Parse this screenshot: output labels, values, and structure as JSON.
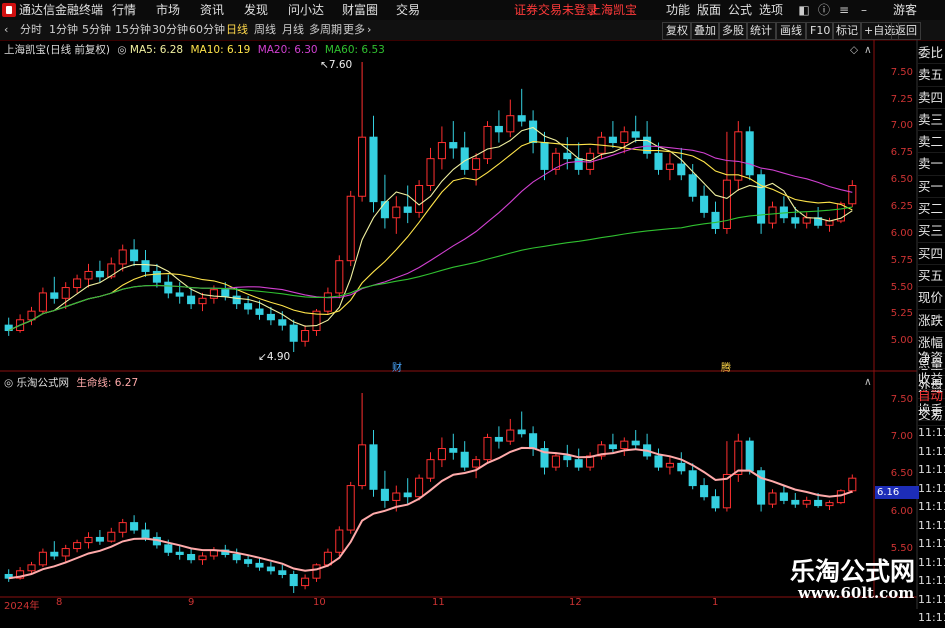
{
  "app": {
    "title": "通达信金融终端",
    "menu": [
      "行情",
      "市场",
      "资讯",
      "发现",
      "问小达",
      "财富圈",
      "交易"
    ],
    "login_text": "证券交易未登录",
    "broker": "上海凯宝",
    "right_menu": [
      "功能",
      "版面",
      "公式",
      "选项"
    ],
    "guest": "游客"
  },
  "toolbar": {
    "periods": [
      "分时",
      "1分钟",
      "5分钟",
      "15分钟",
      "30分钟",
      "60分钟",
      "日线",
      "周线",
      "月线",
      "多周期",
      "更多"
    ],
    "active_period": "日线",
    "right_buttons": [
      "复权",
      "叠加",
      "多股",
      "统计",
      "画线",
      "F10",
      "标记",
      "+自选",
      "返回"
    ]
  },
  "main_chart": {
    "stock_label": "上海凯宝(日线 前复权)",
    "ma": [
      {
        "name": "MA5",
        "value": "6.28",
        "color": "#f0f0a0"
      },
      {
        "name": "MA10",
        "value": "6.19",
        "color": "#ffe44a"
      },
      {
        "name": "MA20",
        "value": "6.30",
        "color": "#d040d0"
      },
      {
        "name": "MA60",
        "value": "6.53",
        "color": "#30c030"
      }
    ],
    "high_mark": "7.60",
    "low_mark": "4.90",
    "event_marks": [
      "财",
      "腾"
    ],
    "y_ticks": [
      "7.50",
      "7.25",
      "7.00",
      "6.75",
      "6.50",
      "6.25",
      "6.00",
      "5.75",
      "5.50",
      "5.25",
      "5.00"
    ]
  },
  "sub_chart": {
    "label": "乐淘公式网",
    "line_name": "生命线",
    "line_value": "6.27",
    "y_ticks": [
      "7.50",
      "7.00",
      "6.50",
      "6.00",
      "5.50"
    ],
    "price_tag": "6.16"
  },
  "x_axis": {
    "labels": [
      "2024年",
      "8",
      "9",
      "10",
      "11",
      "12",
      "1"
    ]
  },
  "right_panel": {
    "items": [
      "委比",
      "卖五",
      "卖四",
      "卖三",
      "卖二",
      "卖一",
      "买一",
      "买二",
      "买三",
      "买四",
      "买五",
      "现价",
      "涨跌",
      "涨幅",
      "总量",
      "外盘",
      "换手",
      "净资",
      "收益",
      "自动",
      "交易"
    ],
    "times": [
      "11:11",
      "11:11",
      "11:11",
      "11:11",
      "11:11",
      "11:11",
      "11:11",
      "11:11",
      "11:11",
      "11:11",
      "11:11"
    ]
  },
  "watermark": {
    "cn": "乐淘公式网",
    "url": "www.60lt.com"
  },
  "colors": {
    "up": "#ff3030",
    "down": "#35d0e0",
    "axis": "#8a1010",
    "life_line": "#ffaaaa"
  },
  "chart_data": {
    "type": "candlestick",
    "ylim": [
      4.8,
      7.7
    ],
    "series": [
      {
        "name": "MA5"
      },
      {
        "name": "MA10"
      },
      {
        "name": "MA20"
      },
      {
        "name": "MA60"
      },
      {
        "name": "生命线"
      }
    ],
    "candles": [
      [
        5.15,
        5.22,
        5.05,
        5.1
      ],
      [
        5.1,
        5.25,
        5.08,
        5.2
      ],
      [
        5.2,
        5.32,
        5.15,
        5.28
      ],
      [
        5.28,
        5.5,
        5.25,
        5.45
      ],
      [
        5.45,
        5.6,
        5.35,
        5.4
      ],
      [
        5.4,
        5.55,
        5.3,
        5.5
      ],
      [
        5.5,
        5.62,
        5.45,
        5.58
      ],
      [
        5.58,
        5.72,
        5.5,
        5.65
      ],
      [
        5.65,
        5.75,
        5.55,
        5.6
      ],
      [
        5.6,
        5.78,
        5.58,
        5.72
      ],
      [
        5.72,
        5.9,
        5.65,
        5.85
      ],
      [
        5.85,
        5.95,
        5.7,
        5.75
      ],
      [
        5.75,
        5.85,
        5.6,
        5.65
      ],
      [
        5.65,
        5.72,
        5.5,
        5.55
      ],
      [
        5.55,
        5.62,
        5.4,
        5.45
      ],
      [
        5.45,
        5.55,
        5.35,
        5.42
      ],
      [
        5.42,
        5.5,
        5.3,
        5.35
      ],
      [
        5.35,
        5.45,
        5.28,
        5.4
      ],
      [
        5.4,
        5.52,
        5.35,
        5.48
      ],
      [
        5.48,
        5.55,
        5.38,
        5.42
      ],
      [
        5.42,
        5.5,
        5.3,
        5.35
      ],
      [
        5.35,
        5.42,
        5.25,
        5.3
      ],
      [
        5.3,
        5.38,
        5.2,
        5.25
      ],
      [
        5.25,
        5.32,
        5.15,
        5.2
      ],
      [
        5.2,
        5.28,
        5.1,
        5.15
      ],
      [
        5.15,
        5.2,
        4.9,
        5.0
      ],
      [
        5.0,
        5.15,
        4.95,
        5.1
      ],
      [
        5.1,
        5.3,
        5.05,
        5.28
      ],
      [
        5.28,
        5.5,
        5.25,
        5.45
      ],
      [
        5.45,
        5.8,
        5.4,
        5.75
      ],
      [
        5.75,
        6.4,
        5.7,
        6.35
      ],
      [
        6.35,
        7.6,
        6.3,
        6.9
      ],
      [
        6.9,
        7.1,
        6.2,
        6.3
      ],
      [
        6.3,
        6.55,
        6.05,
        6.15
      ],
      [
        6.15,
        6.35,
        6.0,
        6.25
      ],
      [
        6.25,
        6.45,
        6.1,
        6.2
      ],
      [
        6.2,
        6.5,
        6.15,
        6.45
      ],
      [
        6.45,
        6.8,
        6.4,
        6.7
      ],
      [
        6.7,
        7.0,
        6.6,
        6.85
      ],
      [
        6.85,
        7.05,
        6.7,
        6.8
      ],
      [
        6.8,
        6.95,
        6.55,
        6.6
      ],
      [
        6.6,
        6.75,
        6.45,
        6.7
      ],
      [
        6.7,
        7.05,
        6.65,
        7.0
      ],
      [
        7.0,
        7.15,
        6.85,
        6.95
      ],
      [
        6.95,
        7.25,
        6.9,
        7.1
      ],
      [
        7.1,
        7.35,
        7.0,
        7.05
      ],
      [
        7.05,
        7.15,
        6.75,
        6.85
      ],
      [
        6.85,
        6.95,
        6.5,
        6.6
      ],
      [
        6.6,
        6.8,
        6.55,
        6.75
      ],
      [
        6.75,
        6.9,
        6.6,
        6.7
      ],
      [
        6.7,
        6.85,
        6.55,
        6.6
      ],
      [
        6.6,
        6.8,
        6.55,
        6.75
      ],
      [
        6.75,
        6.95,
        6.7,
        6.9
      ],
      [
        6.9,
        7.05,
        6.8,
        6.85
      ],
      [
        6.85,
        7.0,
        6.75,
        6.95
      ],
      [
        6.95,
        7.1,
        6.85,
        6.9
      ],
      [
        6.9,
        7.05,
        6.7,
        6.75
      ],
      [
        6.75,
        6.85,
        6.55,
        6.6
      ],
      [
        6.6,
        6.75,
        6.5,
        6.65
      ],
      [
        6.65,
        6.8,
        6.5,
        6.55
      ],
      [
        6.55,
        6.65,
        6.3,
        6.35
      ],
      [
        6.35,
        6.45,
        6.15,
        6.2
      ],
      [
        6.2,
        6.3,
        6.0,
        6.05
      ],
      [
        6.05,
        6.95,
        6.0,
        6.5
      ],
      [
        6.5,
        7.05,
        6.4,
        6.95
      ],
      [
        6.95,
        7.0,
        6.5,
        6.55
      ],
      [
        6.55,
        6.6,
        6.0,
        6.1
      ],
      [
        6.1,
        6.3,
        6.05,
        6.25
      ],
      [
        6.25,
        6.35,
        6.1,
        6.15
      ],
      [
        6.15,
        6.25,
        6.05,
        6.1
      ],
      [
        6.1,
        6.2,
        6.05,
        6.15
      ],
      [
        6.15,
        6.25,
        6.05,
        6.08
      ],
      [
        6.08,
        6.15,
        6.02,
        6.12
      ],
      [
        6.12,
        6.3,
        6.1,
        6.28
      ],
      [
        6.28,
        6.5,
        6.25,
        6.45
      ]
    ]
  }
}
